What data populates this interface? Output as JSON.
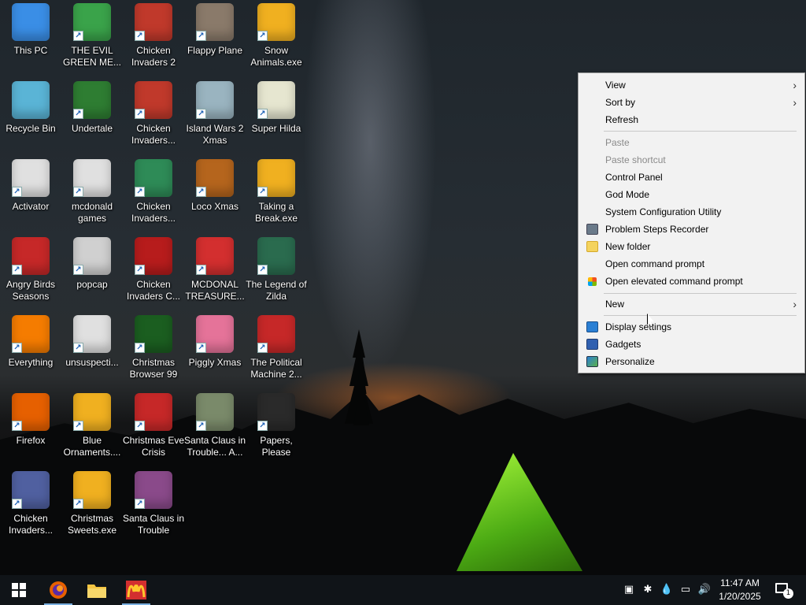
{
  "desktop": {
    "icons": [
      {
        "label": "This PC",
        "symbol": "pc-icon",
        "color": "#3a8ee6"
      },
      {
        "label": "THE EVIL GREEN ME...",
        "symbol": "messenger-icon",
        "color": "#3aa34a"
      },
      {
        "label": "Chicken Invaders 2",
        "symbol": "chicken-icon",
        "color": "#c0392b"
      },
      {
        "label": "Flappy Plane",
        "symbol": "plane-icon",
        "color": "#8a7a6a"
      },
      {
        "label": "Snow Animals.exe",
        "symbol": "package-icon",
        "color": "#f0b020"
      },
      {
        "label": "Recycle Bin",
        "symbol": "recycle-icon",
        "color": "#5ab4d6"
      },
      {
        "label": "Undertale",
        "symbol": "undertale-icon",
        "color": "#2e7d32"
      },
      {
        "label": "Chicken Invaders...",
        "symbol": "chicken-icon",
        "color": "#c0392b"
      },
      {
        "label": "Island Wars 2 Xmas",
        "symbol": "island-icon",
        "color": "#9ab4c0"
      },
      {
        "label": "Super Hilda",
        "symbol": "pixel-icon",
        "color": "#e6e6d0"
      },
      {
        "label": "Activator",
        "symbol": "file-icon",
        "color": "#e0e0e0"
      },
      {
        "label": "mcdonald games",
        "symbol": "file-icon",
        "color": "#e0e0e0"
      },
      {
        "label": "Chicken Invaders...",
        "symbol": "chicken-icon",
        "color": "#2e8b57"
      },
      {
        "label": "Loco Xmas",
        "symbol": "bear-icon",
        "color": "#b5651d"
      },
      {
        "label": "Taking a Break.exe",
        "symbol": "package-icon",
        "color": "#f0b020"
      },
      {
        "label": "Angry Birds Seasons",
        "symbol": "bird-icon",
        "color": "#c62828"
      },
      {
        "label": "popcap",
        "symbol": "popcap-icon",
        "color": "#d0d0d0"
      },
      {
        "label": "Chicken Invaders C...",
        "symbol": "chicken-icon",
        "color": "#b71c1c"
      },
      {
        "label": "MCDONAL TREASURE...",
        "symbol": "mcdonalds-icon",
        "color": "#d32f2f"
      },
      {
        "label": "The Legend of Zilda",
        "symbol": "zilda-icon",
        "color": "#2a6b4e"
      },
      {
        "label": "Everything",
        "symbol": "search-icon",
        "color": "#f57c00"
      },
      {
        "label": "unsuspecti...",
        "symbol": "file-icon",
        "color": "#e0e0e0"
      },
      {
        "label": "Christmas Browser 99",
        "symbol": "tree-icon",
        "color": "#1b5e20"
      },
      {
        "label": "Piggly Xmas",
        "symbol": "pig-icon",
        "color": "#e57399"
      },
      {
        "label": "The Political Machine 2...",
        "symbol": "badge-icon",
        "color": "#c62828"
      },
      {
        "label": "Firefox",
        "symbol": "firefox-icon",
        "color": "#e66000"
      },
      {
        "label": "Blue Ornaments....",
        "symbol": "package-icon",
        "color": "#f0b020"
      },
      {
        "label": "Christmas Eve Crisis",
        "symbol": "santa-icon",
        "color": "#c62828"
      },
      {
        "label": "Santa Claus in Trouble... A...",
        "symbol": "santa-icon",
        "color": "#7a8a6a"
      },
      {
        "label": "Papers, Please",
        "symbol": "papers-icon",
        "color": "#2a2a2a"
      },
      {
        "label": "Chicken Invaders...",
        "symbol": "chicken-icon",
        "color": "#5060a0"
      },
      {
        "label": "Christmas Sweets.exe",
        "symbol": "package-icon",
        "color": "#f0b020"
      },
      {
        "label": "Santa Claus in Trouble",
        "symbol": "santa-icon",
        "color": "#8a4a8a"
      }
    ]
  },
  "context_menu": {
    "view": "View",
    "sort_by": "Sort by",
    "refresh": "Refresh",
    "paste": "Paste",
    "paste_shortcut": "Paste shortcut",
    "control_panel": "Control Panel",
    "god_mode": "God Mode",
    "system_configuration": "System Configuration Utility",
    "problem_steps": "Problem Steps Recorder",
    "new_folder": "New folder",
    "open_cmd": "Open command prompt",
    "open_elevated_cmd": "Open elevated command prompt",
    "new": "New",
    "display_settings": "Display settings",
    "gadgets": "Gadgets",
    "personalize": "Personalize",
    "chevron": "›"
  },
  "taskbar": {
    "time": "11:47 AM",
    "date": "1/20/2025",
    "notification_count": "1"
  }
}
